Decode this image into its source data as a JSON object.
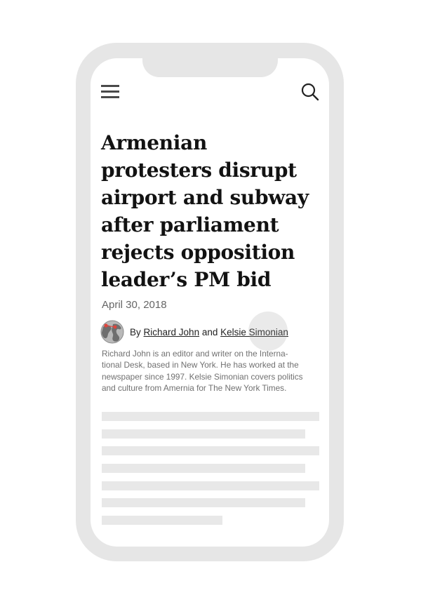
{
  "header": {
    "menu_icon": "hamburger-menu-icon",
    "search_icon": "search-icon"
  },
  "article": {
    "headline_lines": [
      "Armenian",
      "protesters disrupt",
      "airport and subway",
      "after parliament",
      "rejects opposition",
      "leader’s PM bid"
    ],
    "date": "April 30, 2018",
    "byline": {
      "prefix": "By",
      "author1": "Richard John",
      "conjunction": "and",
      "author2": "Kelsie Simonian"
    },
    "bio_lines": [
      "Richard John is an editor and writer on the Interna-",
      "tional Desk, based in New York. He has worked at the",
      "newspaper since 1997. Kelsie Simonian covers politics",
      "and culture from Amernia for The New York Times."
    ]
  },
  "colors": {
    "frame": "#e6e6e6",
    "headline": "#121212",
    "muted_text": "#707070",
    "placeholder": "#e8e8e8",
    "avatar_accent": "#e0443c"
  }
}
